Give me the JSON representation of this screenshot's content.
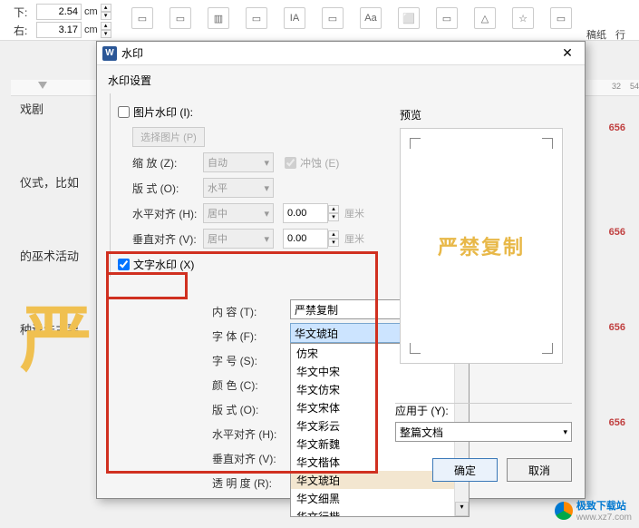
{
  "margins": {
    "bottom_label": "下:",
    "bottom_value": "2.54",
    "right_label": "右:",
    "right_value": "3.17",
    "unit": "cm"
  },
  "doc_texts": {
    "t1": "戏剧",
    "t2": "仪式，比如",
    "t3": "的巫术活动",
    "t4": "种说法主要"
  },
  "side_marker": "656",
  "ruler_nums": [
    "32",
    "54"
  ],
  "dialog": {
    "title": "水印",
    "group": "水印设置",
    "img_watermark": "图片水印 (I):",
    "select_pic": "选择图片 (P)",
    "zoom": "缩   放 (Z):",
    "zoom_val": "自动",
    "erode": "冲蚀 (E)",
    "layout": "版   式 (O):",
    "layout_val": "水平",
    "halign": "水平对齐 (H):",
    "halign_val": "居中",
    "valign": "垂直对齐 (V):",
    "valign_val": "居中",
    "offset": "0.00",
    "unit_cm": "厘米",
    "text_watermark": "文字水印 (X)",
    "content": "内   容 (T):",
    "content_val": "严禁复制",
    "font": "字   体 (F):",
    "font_val": "华文琥珀",
    "fontsize": "字   号 (S):",
    "color": "颜   色 (C):",
    "layout2": "版   式 (O):",
    "halign2": "水平对齐 (H):",
    "valign2": "垂直对齐 (V):",
    "transparency": "透 明 度 (R):",
    "font_options": [
      "仿宋",
      "华文中宋",
      "华文仿宋",
      "华文宋体",
      "华文彩云",
      "华文新魏",
      "华文楷体",
      "华文琥珀",
      "华文细黑",
      "华文行楷"
    ],
    "preview": "预览",
    "preview_wm": "严禁复制",
    "apply_to": "应用于 (Y):",
    "apply_val": "整篇文档",
    "ok": "确定",
    "cancel": "取消"
  },
  "site": {
    "name": "极致下载站",
    "url": "www.xz7.com"
  }
}
